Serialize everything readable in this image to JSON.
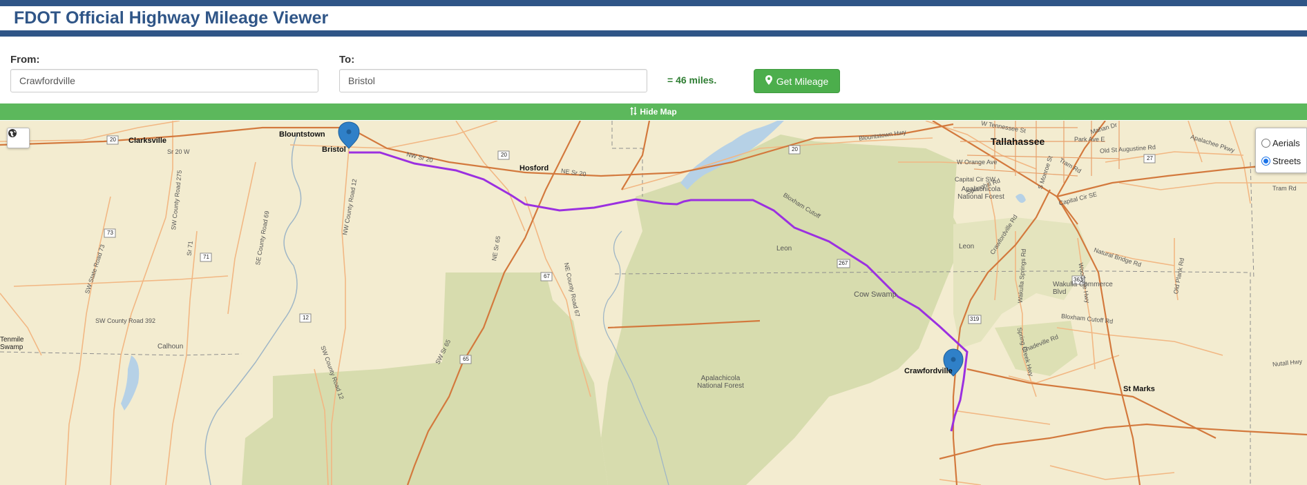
{
  "app": {
    "title": "FDOT Official Highway Mileage Viewer"
  },
  "form": {
    "from_label": "From:",
    "from_value": "Crawfordville",
    "to_label": "To:",
    "to_value": "Bristol",
    "result_text": "= 46 miles.",
    "get_mileage_label": "Get Mileage"
  },
  "toggle": {
    "hide_map_label": "Hide Map"
  },
  "layers": {
    "options": [
      {
        "label": "Aerials",
        "selected": false
      },
      {
        "label": "Streets",
        "selected": true
      }
    ]
  },
  "map": {
    "colors": {
      "route": "#9b30e0",
      "marker": "#2f80c8",
      "forest": "#d6dcae",
      "water": "#b6d1e6",
      "major_road": "#d3793d",
      "minor_road": "#f2b783"
    },
    "labels": {
      "bristol": "Bristol",
      "blountstown": "Blountstown",
      "clarksville": "Clarksville",
      "tallahassee": "Tallahassee",
      "hosford": "Hosford",
      "crawfordville": "Crawfordville",
      "st_marks": "St Marks",
      "cow_swamp": "Cow Swamp",
      "apalachicola_nf_north": "Apalachicola National Forest",
      "apalachicola_nf_south": "Apalachicola National Forest",
      "leon_1": "Leon",
      "leon_2": "Leon",
      "calhoun": "Calhoun",
      "wakulla_commerce": "Wakulla Commerce Blvd",
      "tenmile": "Tenmile Swamp",
      "blountstown_hwy": "Blountstown Hwy",
      "w_orange_ave": "W Orange Ave",
      "capital_cir_sw": "Capital Cir SW",
      "springhill_rd": "Springhill Rd",
      "crawfordville_rd": "Crawfordville Rd",
      "sw_county_road_392": "SW County Road 392",
      "nw_county_road_12": "NW County Road 12",
      "nw_sr_20": "NW Sr 20",
      "ne_sr_20": "NE Sr 20",
      "bloxham_cutoff": "Bloxham Cutoff",
      "bloxham_cutoff_rd": "Bloxham Cutoff Rd",
      "natural_bridge_rd": "Natural Bridge Rd",
      "shadeville_rd": "Shadeville Rd",
      "tram_rd": "Tram Rd",
      "nutall_hwy": "Nutall Hwy",
      "s_monroe_st": "S Monroe St",
      "ne_county_road_67": "NE County Road 67",
      "sw_sr_65": "SW Sr 65",
      "ne_sr_65": "NE Sr 65",
      "sw_county_road_12": "SW County Road 12",
      "se_county_road_69": "SE County Road 69",
      "sw_county_road_275": "SW County Road 275",
      "sw_state_road_73": "SW State Road 73",
      "sr_20_w": "Sr 20 W",
      "sr_71": "Sr 71",
      "woodville_hwy": "Woodville Hwy",
      "wakulla_springs_rd": "Wakulla Springs Rd",
      "old_plank_rd": "Old Plank Rd",
      "old_st_augustine_rd": "Old St Augustine Rd",
      "apalachee_pkwy": "Apalachee Pkwy",
      "capital_cir_se": "Capital Cir SE",
      "park_ave_e": "Park Ave E",
      "w_tennessee_st": "W Tennessee St",
      "mahan_dr": "Mahan Dr",
      "spring_creek_hwy": "Spring Creek Hwy",
      "shield_20_a": "20",
      "shield_20_b": "20",
      "shield_20_c": "20",
      "shield_73": "73",
      "shield_71": "71",
      "shield_12": "12",
      "shield_65": "65",
      "shield_67": "67",
      "shield_267": "267",
      "shield_319": "319",
      "shield_363": "363",
      "shield_27": "27"
    }
  }
}
